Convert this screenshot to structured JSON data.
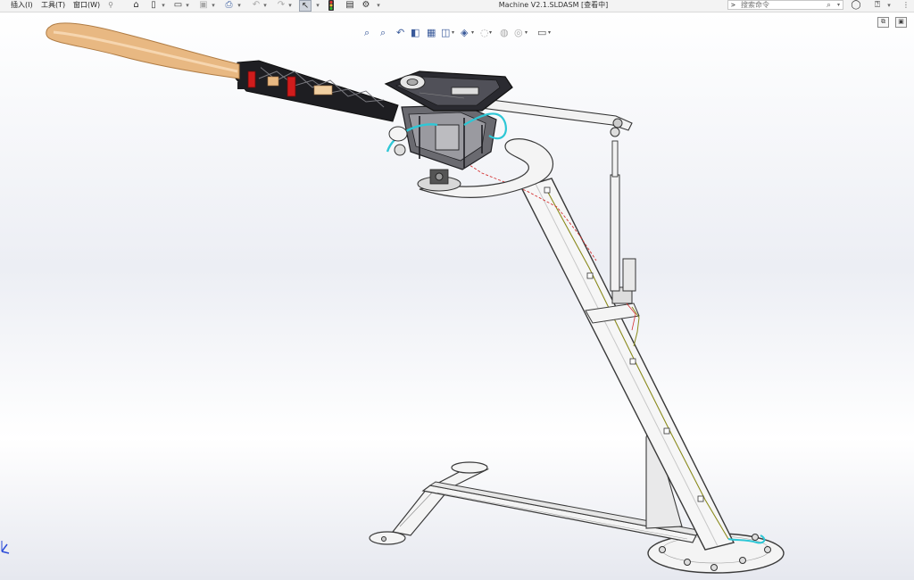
{
  "menus": [
    "插入(I)",
    "工具(T)",
    "窗口(W)"
  ],
  "icons": {
    "pin": "pin-icon",
    "home": "home-icon",
    "new": "new-document-icon",
    "open": "open-icon",
    "save": "save-icon",
    "print": "print-icon",
    "undo": "undo-icon",
    "redo": "redo-icon",
    "select": "select-pointer-icon",
    "rebuild": "traffic-light-icon",
    "file_props": "file-properties-icon",
    "options": "gear-icon",
    "search": "search-icon",
    "help": "help-icon",
    "user": "user-icon",
    "more": "more-icon"
  },
  "document": {
    "title": "Machine V2.1.SLDASM [查看中]"
  },
  "search": {
    "placeholder": "搜索命令",
    "prompt": ">"
  },
  "colors": {
    "toolbar_bg": "#f3f3f3",
    "stand": "#f4f4f4",
    "stand_outline": "#3a3a3a",
    "frame_dark": "#1e1e22",
    "propeller": "#e8b882",
    "motor_mount": "#d01c1c",
    "cable_cyan": "#2ec7d6",
    "cable_olive": "#8a8a1c",
    "dashed_red": "#d43030"
  }
}
